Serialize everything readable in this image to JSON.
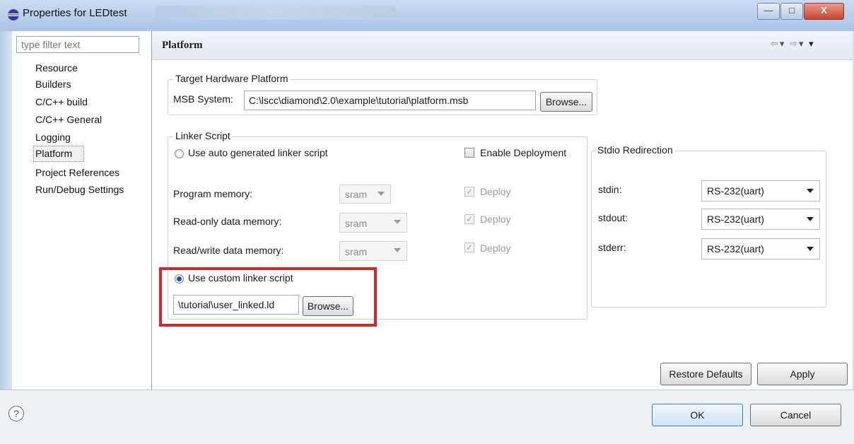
{
  "window": {
    "title": "Properties for LEDtest",
    "controls": {
      "minimize": "—",
      "maximize": "□",
      "close": "X"
    }
  },
  "sidebar": {
    "filter_placeholder": "type filter text",
    "items": [
      {
        "label": "Resource"
      },
      {
        "label": "Builders"
      },
      {
        "label": "C/C++ build"
      },
      {
        "label": "C/C++ General"
      },
      {
        "label": "Logging"
      },
      {
        "label": "Platform",
        "selected": true
      },
      {
        "label": "Project References"
      },
      {
        "label": "Run/Debug Settings"
      }
    ]
  },
  "page": {
    "title": "Platform",
    "nav_icons": [
      "back-arrow-icon",
      "dropdown-icon",
      "forward-arrow-icon",
      "dropdown-icon",
      "menu-icon"
    ]
  },
  "target_hw": {
    "group_label": "Target Hardware Platform",
    "msb_label": "MSB System:",
    "msb_value": "C:\\lscc\\diamond\\2.0\\example\\tutorial\\platform.msb",
    "browse_label": "Browse..."
  },
  "linker": {
    "group_label": "Linker Script",
    "auto_label": "Use auto generated linker script",
    "enable_deploy_label": "Enable Deployment",
    "rows": [
      {
        "label": "Program memory:",
        "value": "sram",
        "deploy": "Deploy"
      },
      {
        "label": "Read-only data memory:",
        "value": "sram",
        "deploy": "Deploy"
      },
      {
        "label": "Read/write data memory:",
        "value": "sram",
        "deploy": "Deploy"
      }
    ],
    "custom_label": "Use custom linker script",
    "custom_value": "\\tutorial\\user_linked.ld",
    "custom_browse_label": "Browse..."
  },
  "stdio": {
    "group_label": "Stdio Redirection",
    "rows": [
      {
        "label": "stdin:",
        "value": "RS-232(uart)"
      },
      {
        "label": "stdout:",
        "value": "RS-232(uart)"
      },
      {
        "label": "stderr:",
        "value": "RS-232(uart)"
      }
    ]
  },
  "actions": {
    "restore_defaults": "Restore Defaults",
    "apply": "Apply",
    "ok": "OK",
    "cancel": "Cancel",
    "help_icon_glyph": "?"
  },
  "colors": {
    "highlight_box": "#d4262e",
    "radio_selected": "#1c4f9c"
  }
}
